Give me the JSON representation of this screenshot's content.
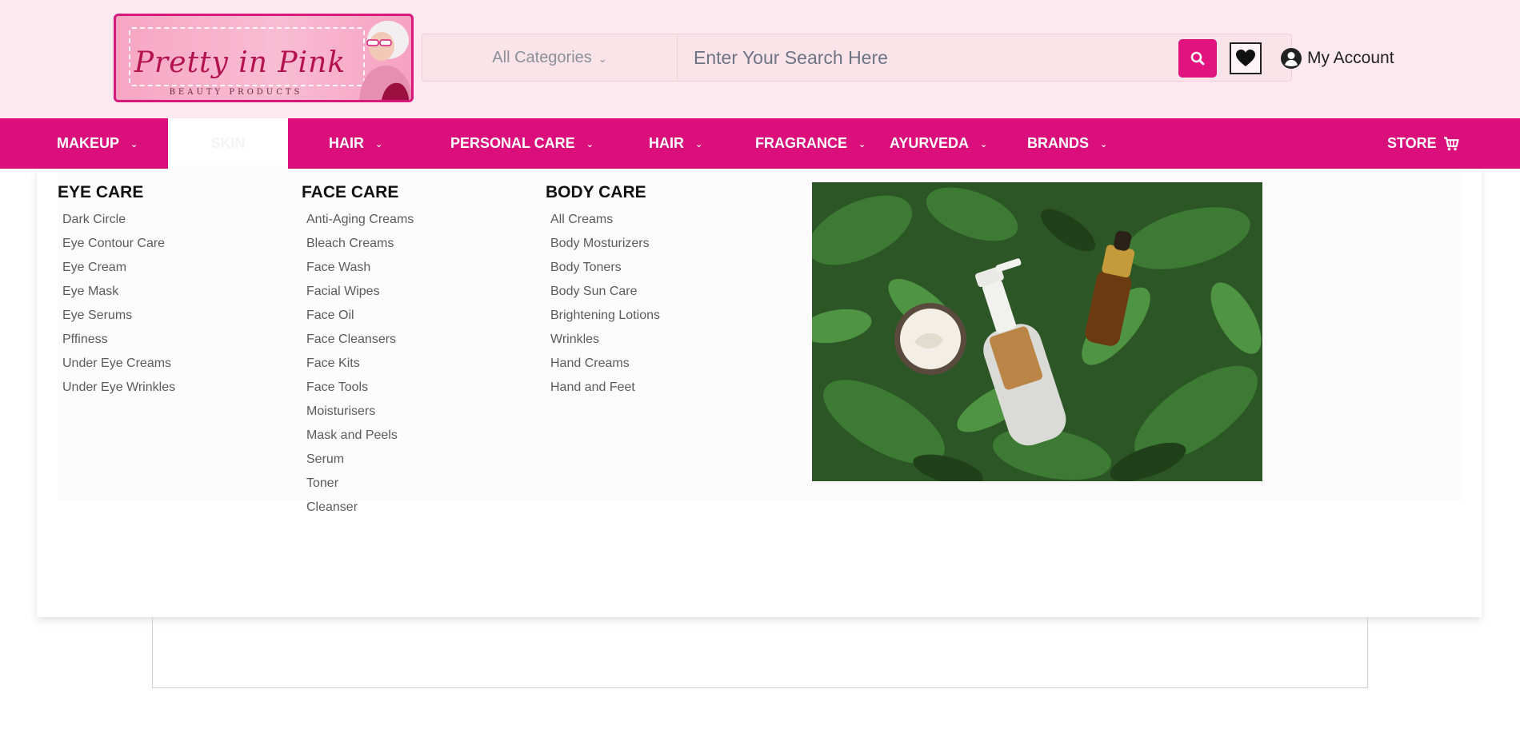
{
  "header": {
    "logo_text": "Pretty in Pink",
    "logo_tagline": "BEAUTY PRODUCTS",
    "category_select": "All Categories",
    "search_placeholder": "Enter Your Search Here",
    "account_label": "My Account"
  },
  "nav": {
    "items": [
      {
        "label": "MAKEUP"
      },
      {
        "label": "SKIN"
      },
      {
        "label": "HAIR"
      },
      {
        "label": "PERSONAL CARE"
      },
      {
        "label": "HAIR"
      },
      {
        "label": "FRAGRANCE"
      },
      {
        "label": "AYURVEDA"
      },
      {
        "label": "BRANDS"
      }
    ],
    "store_label": "STORE"
  },
  "menu": {
    "columns": [
      {
        "title": "EYE CARE",
        "links": [
          "Dark Circle",
          "Eye Contour Care",
          "Eye Cream",
          "Eye Mask",
          "Eye Serums",
          "Pffiness",
          "Under Eye Creams",
          "Under Eye Wrinkles"
        ]
      },
      {
        "title": "FACE CARE",
        "links": [
          "Anti-Aging Creams",
          "Bleach Creams",
          "Face Wash",
          "Facial Wipes",
          "Face Oil",
          "Face Cleansers",
          "Face Kits",
          "Face Tools",
          "Moisturisers",
          "Mask and Peels",
          "Serum",
          "Toner",
          "Cleanser"
        ]
      },
      {
        "title": "BODY CARE",
        "links": [
          "All Creams",
          "Body Mosturizers",
          "Body Toners",
          "Body Sun Care",
          "Brightening Lotions",
          "Wrinkles",
          "Hand Creams",
          "Hand and Feet"
        ]
      }
    ]
  },
  "colors": {
    "brand_pink": "#db0f7c",
    "header_bg": "#fde9ef"
  }
}
